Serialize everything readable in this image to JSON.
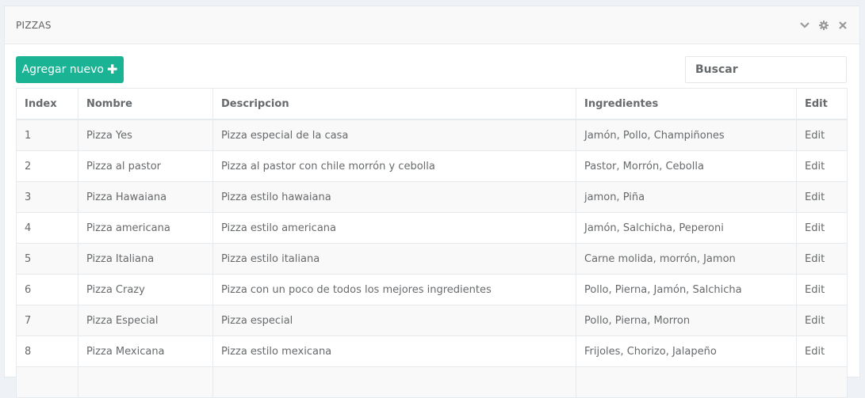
{
  "panel": {
    "title": "PIZZAS",
    "tools": [
      "chevron-down-icon",
      "gear-icon",
      "close-icon"
    ]
  },
  "toolbar": {
    "add_label": "Agregar nuevo",
    "search_placeholder": "Buscar"
  },
  "table": {
    "headers": [
      "Index",
      "Nombre",
      "Descripcion",
      "Ingredientes",
      "Edit"
    ],
    "rows": [
      {
        "index": "1",
        "nombre": "Pizza Yes",
        "descripcion": "Pizza especial de la casa",
        "ingredientes": "Jamón, Pollo, Champiñones",
        "edit": "Edit"
      },
      {
        "index": "2",
        "nombre": "Pizza al pastor",
        "descripcion": "Pizza al pastor con chile morrón y cebolla",
        "ingredientes": "Pastor, Morrón, Cebolla",
        "edit": "Edit"
      },
      {
        "index": "3",
        "nombre": "Pizza Hawaiana",
        "descripcion": "Pizza estilo hawaiana",
        "ingredientes": "jamon, Piña",
        "edit": "Edit"
      },
      {
        "index": "4",
        "nombre": "Pizza americana",
        "descripcion": "Pizza estilo americana",
        "ingredientes": "Jamón, Salchicha, Peperoni",
        "edit": "Edit"
      },
      {
        "index": "5",
        "nombre": "Pizza Italiana",
        "descripcion": "Pizza estilo italiana",
        "ingredientes": "Carne molida, morrón, Jamon",
        "edit": "Edit"
      },
      {
        "index": "6",
        "nombre": "Pizza Crazy",
        "descripcion": "Pizza con un poco de todos los mejores ingredientes",
        "ingredientes": "Pollo, Pierna, Jamón, Salchicha",
        "edit": "Edit"
      },
      {
        "index": "7",
        "nombre": "Pizza Especial",
        "descripcion": "Pizza especial",
        "ingredientes": "Pollo, Pierna, Morron",
        "edit": "Edit"
      },
      {
        "index": "8",
        "nombre": "Pizza Mexicana",
        "descripcion": "Pizza estilo mexicana",
        "ingredientes": "Frijoles, Chorizo, Jalapeño",
        "edit": "Edit"
      },
      {
        "index": "",
        "nombre": "",
        "descripcion": "",
        "ingredientes": "",
        "edit": ""
      }
    ]
  },
  "colors": {
    "accent": "#1ab394",
    "text": "#676a6c",
    "border": "#e7eaec"
  }
}
